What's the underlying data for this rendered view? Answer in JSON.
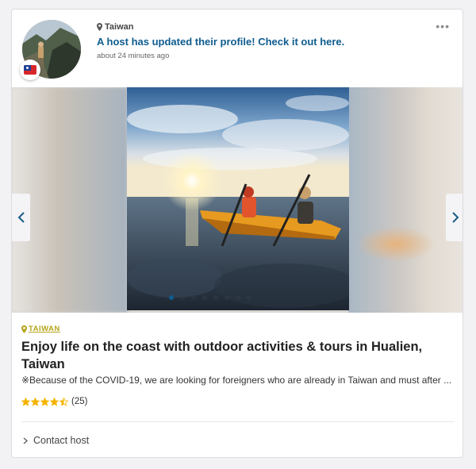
{
  "post": {
    "location": "Taiwan",
    "headline": "A host has updated their profile! Check it out here.",
    "time_ago": "about 24 minutes ago",
    "more_icon": "more-horizontal-icon"
  },
  "gallery": {
    "slide_count": 8,
    "active_slide": 1
  },
  "listing": {
    "location_tag": "TAIWAN",
    "title": "Enjoy life on the coast with outdoor activities & tours in Hualien, Taiwan",
    "description": "※Because of the COVID-19, we are looking for foreigners who are already in Taiwan and must after ...",
    "rating_stars": 4.5,
    "review_count": "(25)",
    "contact_label": "Contact host"
  },
  "colors": {
    "link": "#0f5c8f",
    "tag": "#b5a41a",
    "star": "#f4b400"
  }
}
